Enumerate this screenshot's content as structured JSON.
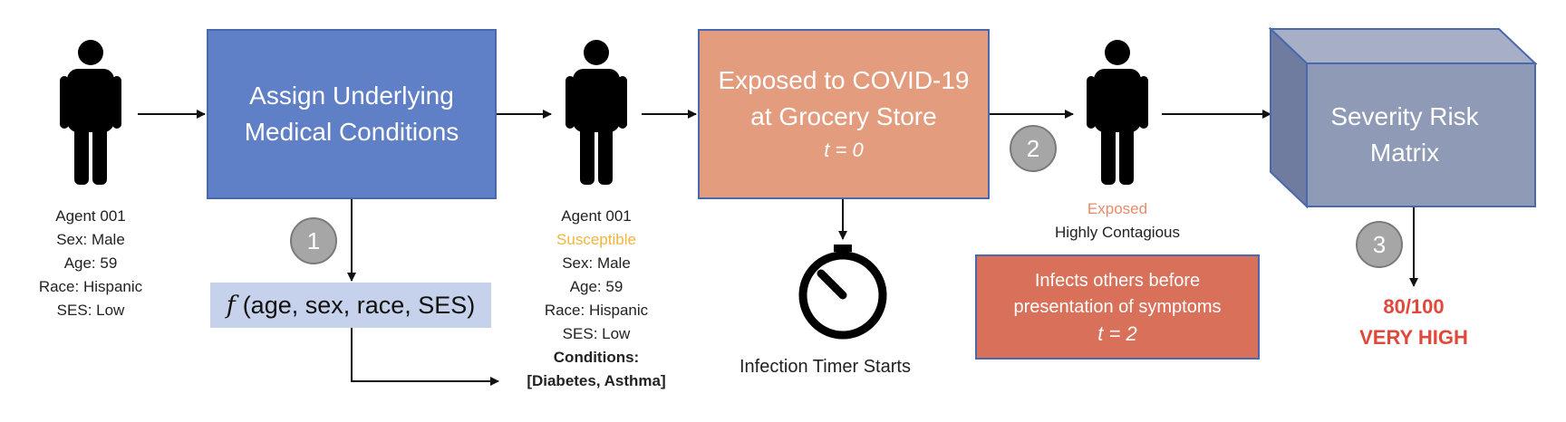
{
  "colors": {
    "blue_box": "#5f7fc6",
    "orange_box": "#e39c7d",
    "infect_box": "#d8705a",
    "func_box": "#c6d2eb",
    "cube": "#8e9ab6",
    "susceptible": "#f2b43c",
    "exposed": "#e8896a",
    "risk": "#e0483a",
    "step_circle": "#a6a6a6"
  },
  "agent1": {
    "lines": [
      "Agent 001",
      "Sex: Male",
      "Age: 59",
      "Race: Hispanic",
      "SES: Low"
    ]
  },
  "box_assign": {
    "line1": "Assign Underlying",
    "line2": "Medical Conditions"
  },
  "step1": "1",
  "func": {
    "symbol": "f",
    "args": "(age, sex, race, SES)"
  },
  "agent2": {
    "id": "Agent 001",
    "status": "Susceptible",
    "lines": [
      "Sex: Male",
      "Age: 59",
      "Race: Hispanic",
      "SES: Low"
    ],
    "conditions_label": "Conditions:",
    "conditions": "[Diabetes, Asthma]"
  },
  "box_exposed": {
    "line1": "Exposed to COVID-19",
    "line2": "at Grocery Store",
    "time": "t = 0"
  },
  "timer": {
    "icon": "stopwatch-icon",
    "label": "Infection Timer Starts"
  },
  "step2": "2",
  "agent3": {
    "status": "Exposed",
    "note": "Highly Contagious"
  },
  "infect_box": {
    "line1": "Infects others before",
    "line2": "presentation of symptoms",
    "time": "t = 2"
  },
  "cube": {
    "line1": "Severity Risk",
    "line2": "Matrix"
  },
  "step3": "3",
  "risk": {
    "score": "80/100",
    "level": "VERY HIGH"
  }
}
